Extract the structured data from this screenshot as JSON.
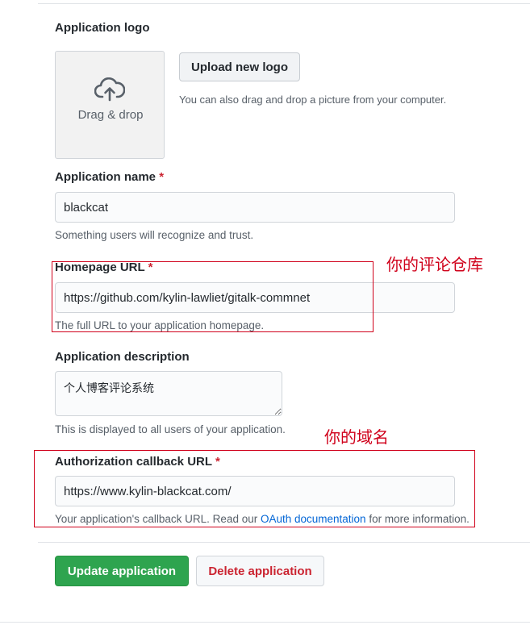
{
  "logo": {
    "label": "Application logo",
    "dropzone_text": "Drag & drop",
    "upload_button": "Upload new logo",
    "upload_hint": "You can also drag and drop a picture from your computer."
  },
  "name": {
    "label": "Application name",
    "required_mark": "*",
    "value": "blackcat",
    "hint": "Something users will recognize and trust."
  },
  "homepage": {
    "label": "Homepage URL",
    "required_mark": "*",
    "value": "https://github.com/kylin-lawliet/gitalk-commnet",
    "hint": "The full URL to your application homepage.",
    "annotation": "你的评论仓库"
  },
  "description": {
    "label": "Application description",
    "value": "个人博客评论系统",
    "hint": "This is displayed to all users of your application."
  },
  "callback": {
    "label": "Authorization callback URL",
    "required_mark": "*",
    "value": "https://www.kylin-blackcat.com/",
    "hint_prefix": "Your application's callback URL. Read our ",
    "hint_link": "OAuth documentation",
    "hint_suffix": " for more information.",
    "annotation": "你的域名"
  },
  "actions": {
    "update": "Update application",
    "delete": "Delete application"
  },
  "colors": {
    "annotation_red": "#d0011b",
    "update_green": "#2ea44f",
    "delete_red": "#cb2431",
    "link_blue": "#0366d6"
  }
}
